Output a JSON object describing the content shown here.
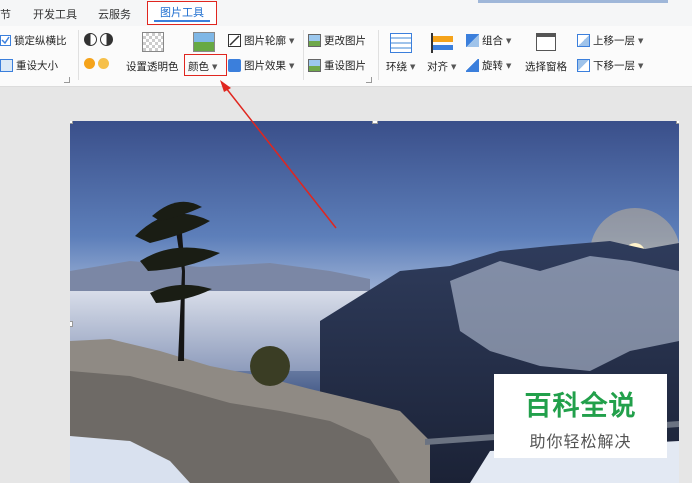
{
  "tabs": {
    "partial": "节",
    "dev_tools": "开发工具",
    "cloud": "云服务",
    "picture_tools": "图片工具"
  },
  "ribbon": {
    "lock_ratio": "锁定纵横比",
    "reset_size": "重设大小",
    "set_transparent": "设置透明色",
    "color": "颜色",
    "picture_outline": "图片轮廓",
    "picture_effect": "图片效果",
    "change_picture": "更改图片",
    "reset_picture": "重设图片",
    "wrap": "环绕",
    "align": "对齐",
    "group": "组合",
    "rotate": "旋转",
    "selection_pane": "选择窗格",
    "bring_forward": "上移一层",
    "send_backward": "下移一层"
  },
  "watermark": {
    "title": "百科全说",
    "subtitle": "助你轻松解决"
  },
  "colors": {
    "highlight_red": "#e0261f",
    "tab_blue": "#1f6fd0",
    "watermark_green": "#22a04b"
  }
}
